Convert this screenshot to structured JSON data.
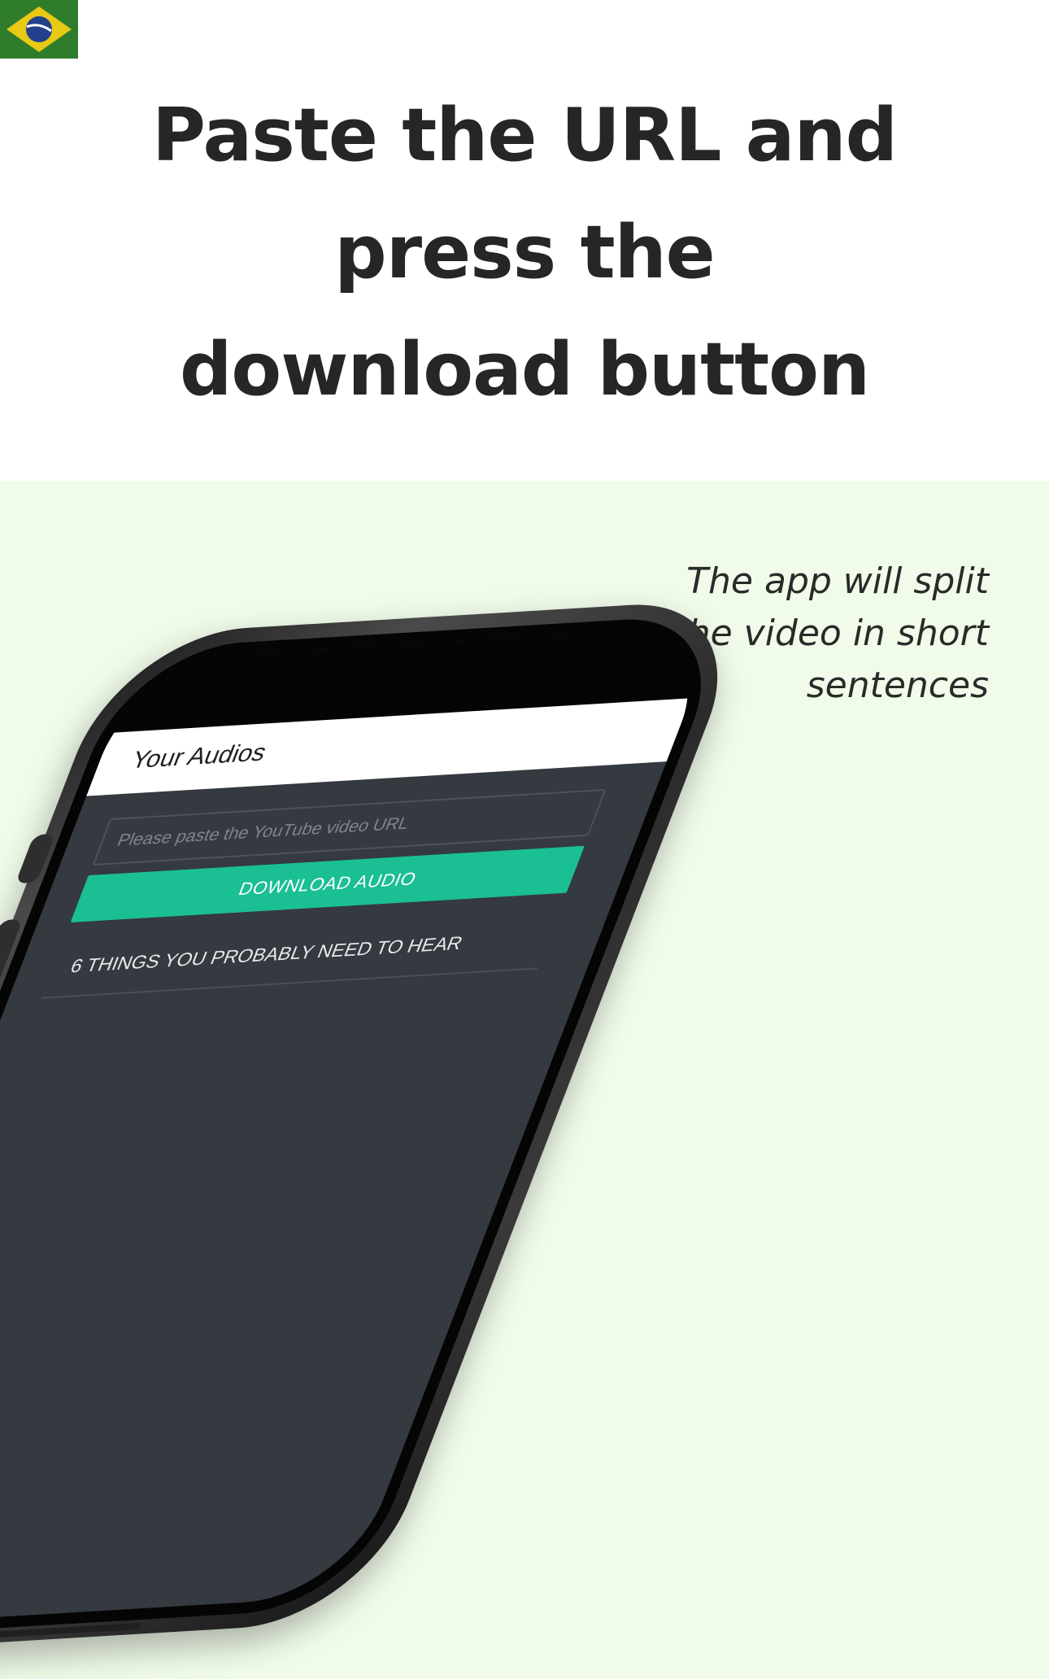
{
  "header": {
    "flag_icon": "brazil-flag-icon",
    "title_lines": [
      "Paste the URL and",
      "press the",
      "download button"
    ]
  },
  "caption": {
    "lines": [
      "The app will split",
      "the video in short",
      "sentences"
    ]
  },
  "app": {
    "title": "Your Audios",
    "url_input": {
      "placeholder": "Please paste the YouTube video URL",
      "value": ""
    },
    "download_button_label": "DOWNLOAD AUDIO",
    "audios": [
      {
        "title": "6 THINGS YOU PROBABLY NEED TO HEAR"
      }
    ]
  },
  "colors": {
    "section_background": "#f0fbe9",
    "app_screen": "#353940",
    "download_button": "#1abf93",
    "headline_text": "#262626"
  }
}
